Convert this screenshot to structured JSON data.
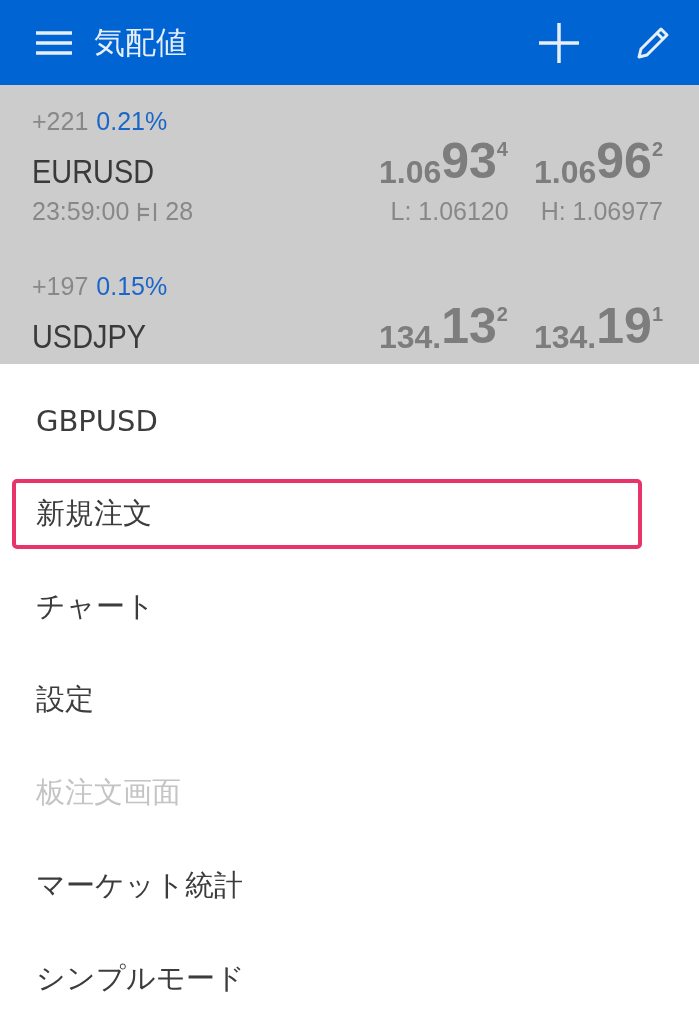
{
  "toolbar": {
    "title": "気配値"
  },
  "quotes": [
    {
      "change": "+221",
      "percent": "0.21%",
      "symbol": "EURUSD",
      "time": "23:59:00",
      "spread": "28",
      "bid": [
        "1.06",
        "93",
        "4"
      ],
      "ask": [
        "1.06",
        "96",
        "2"
      ],
      "low": "L: 1.06120",
      "high": "H: 1.06977"
    },
    {
      "change": "+197",
      "percent": "0.15%",
      "symbol": "USDJPY",
      "bid": [
        "134.",
        "13",
        "2"
      ],
      "ask": [
        "134.",
        "19",
        "1"
      ]
    }
  ],
  "menu": [
    {
      "label": "GBPUSD",
      "disabled": false,
      "highlighted": false
    },
    {
      "label": "新規注文",
      "disabled": false,
      "highlighted": true
    },
    {
      "label": "チャート",
      "disabled": false,
      "highlighted": false
    },
    {
      "label": "設定",
      "disabled": false,
      "highlighted": false
    },
    {
      "label": "板注文画面",
      "disabled": true,
      "highlighted": false
    },
    {
      "label": "マーケット統計",
      "disabled": false,
      "highlighted": false
    },
    {
      "label": "シンプルモード",
      "disabled": false,
      "highlighted": false
    }
  ]
}
